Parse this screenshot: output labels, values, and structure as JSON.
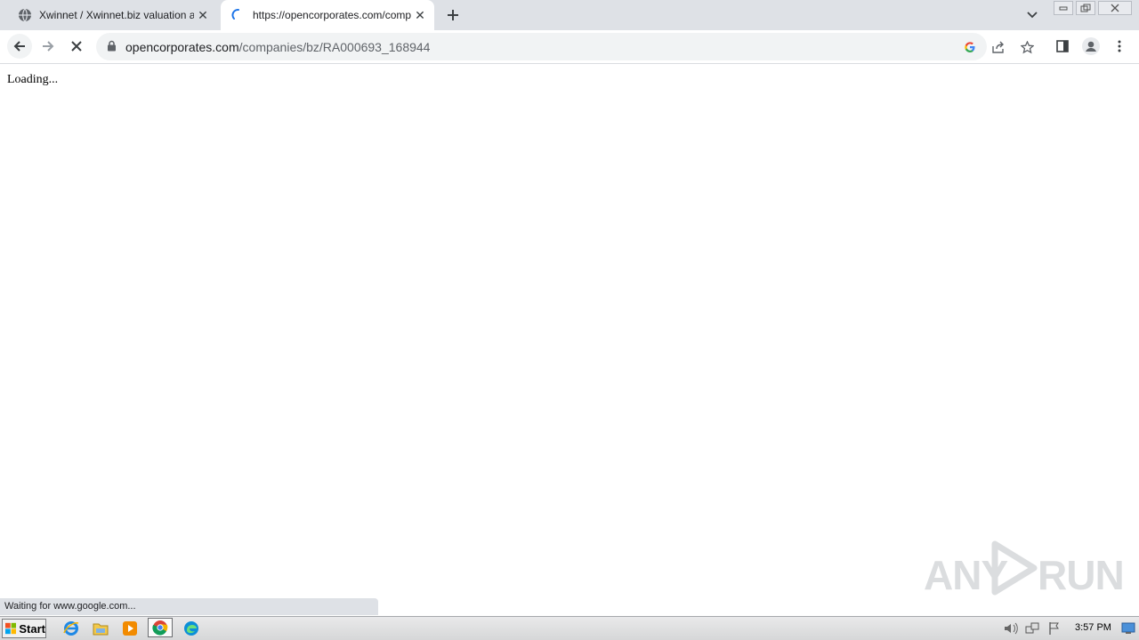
{
  "tabs": [
    {
      "title": "Xwinnet / Xwinnet.biz valuation and",
      "active": false,
      "favicon": "globe-icon"
    },
    {
      "title": "https://opencorporates.com/compar",
      "active": true,
      "favicon": "loading-spinner-icon"
    }
  ],
  "toolbar": {
    "url_host": "opencorporates.com",
    "url_path": "/companies/bz/RA000693_168944"
  },
  "page": {
    "text": "Loading..."
  },
  "status_bar": {
    "text": "Waiting for www.google.com..."
  },
  "watermark": {
    "left": "ANY",
    "right": "RUN"
  },
  "taskbar": {
    "start_label": "Start",
    "clock": "3:57 PM",
    "pinned": [
      "ie-icon",
      "explorer-icon",
      "media-player-icon",
      "chrome-icon",
      "edge-icon"
    ]
  },
  "colors": {
    "tab_strip": "#dee1e6",
    "accent_blue": "#1a73e8"
  }
}
